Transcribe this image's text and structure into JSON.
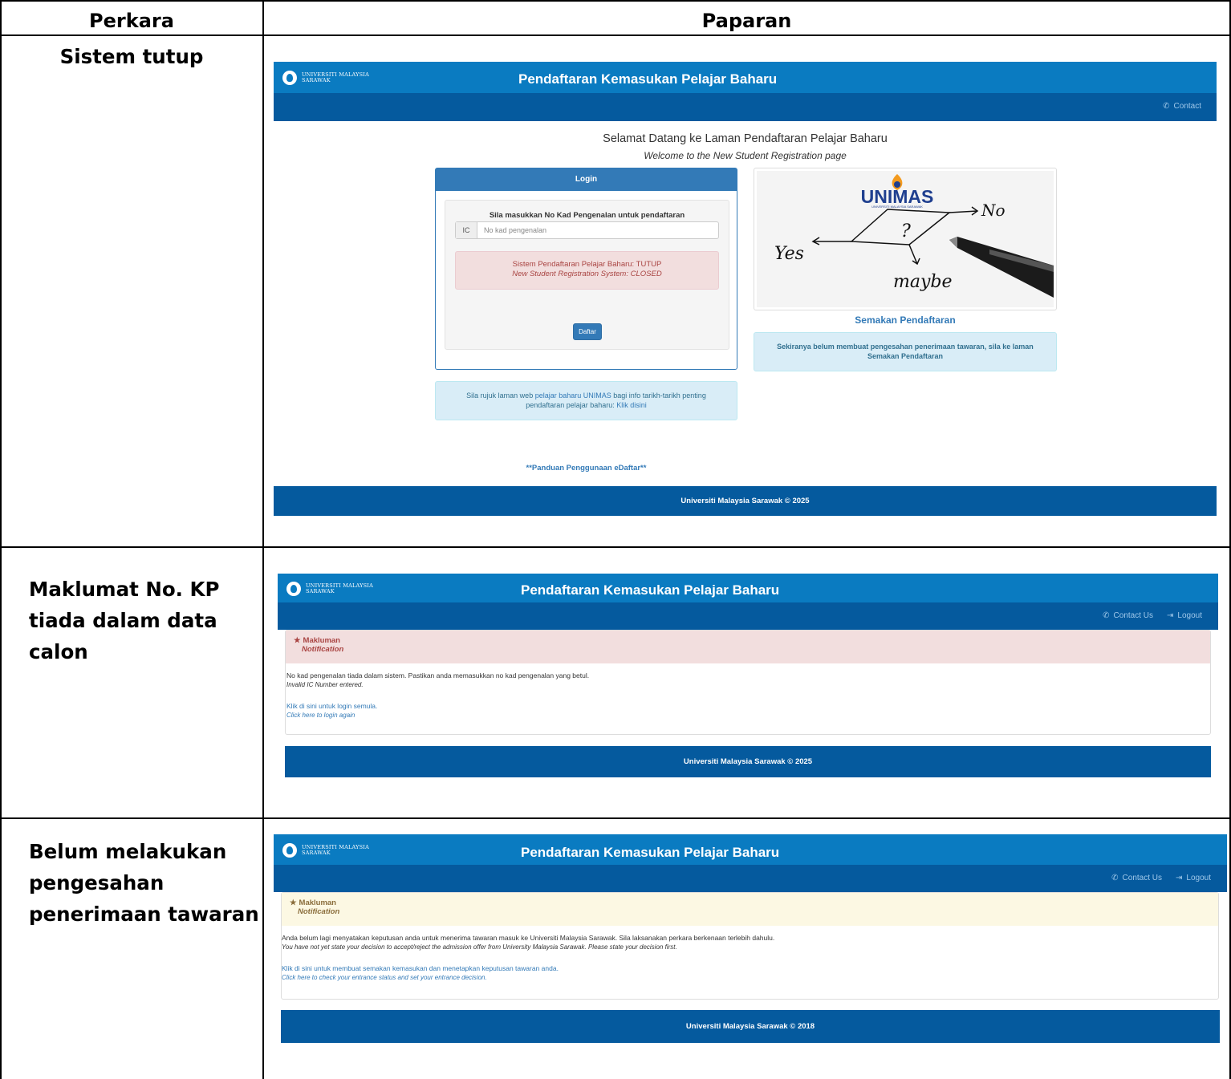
{
  "table": {
    "header_left": "Perkara",
    "header_right": "Paparan",
    "rows": [
      {
        "label_lines": [
          "Sistem tutup"
        ]
      },
      {
        "label_lines": [
          "Maklumat No. KP",
          "tiada dalam data",
          "calon"
        ]
      },
      {
        "label_lines": [
          "Belum melakukan",
          "pengesahan",
          "penerimaan tawaran"
        ]
      }
    ]
  },
  "app": {
    "logo_line1": "UNIVERSITI MALAYSIA",
    "logo_line2": "SARAWAK",
    "title": "Pendaftaran Kemasukan Pelajar Baharu"
  },
  "screen1": {
    "nav_contact": "Contact",
    "welcome_title": "Selamat Datang ke Laman Pendaftaran Pelajar Baharu",
    "welcome_sub": "Welcome to the New Student Registration page",
    "login_title": "Login",
    "login_prompt": "Sila masukkan No Kad Pengenalan untuk pendaftaran",
    "ic_addon": "IC",
    "ic_placeholder": "No kad pengenalan",
    "closed_ms": "Sistem Pendaftaran Pelajar Baharu: TUTUP",
    "closed_en": "New Student Registration System: CLOSED",
    "daftar_button": "Daftar",
    "info_prefix": "Sila rujuk laman web ",
    "info_link": "pelajar baharu UNIMAS",
    "info_middle": " bagi info tarikh-tarikh penting pendaftaran pelajar baharu: ",
    "info_link2": "Klik disini",
    "panduan": "**Panduan Penggunaan eDaftar**",
    "image_brand": "UNIMAS",
    "image_brand_sub": "UNIVERSITI MALAYSIA SARAWAK",
    "image_words": {
      "yes": "Yes",
      "no": "No",
      "maybe": "maybe",
      "q": "?"
    },
    "semakan_title": "Semakan Pendaftaran",
    "semakan_text": "Sekiranya belum membuat pengesahan penerimaan tawaran, sila ke laman Semakan Pendaftaran",
    "footer": "Universiti Malaysia Sarawak © 2025"
  },
  "screen2": {
    "nav_contact": "Contact Us",
    "nav_logout": "Logout",
    "notif_title": "Makluman",
    "notif_sub": "Notification",
    "msg_ms": "No kad pengenalan tiada dalam sistem. Pastikan anda memasukkan no kad pengenalan yang betul.",
    "msg_en": "Invalid IC Number entered.",
    "link_ms": "Klik di sini untuk login semula.",
    "link_en": "Click here to login again",
    "footer": "Universiti Malaysia Sarawak © 2025"
  },
  "screen3": {
    "nav_contact": "Contact Us",
    "nav_logout": "Logout",
    "notif_title": "Makluman",
    "notif_sub": "Notification",
    "msg_ms": "Anda belum lagi menyatakan keputusan anda untuk menerima tawaran masuk ke Universiti Malaysia Sarawak. Sila laksanakan perkara berkenaan terlebih dahulu.",
    "msg_en": "You have not yet state your decision to accept/reject the admission offer from University Malaysia Sarawak. Please state your decision first.",
    "link_ms": "Klik di sini untuk membuat semakan kemasukan dan menetapkan keputusan tawaran anda.",
    "link_en": "Click here to check your entrance status and set your entrance decision.",
    "footer": "Universiti Malaysia Sarawak © 2018"
  },
  "colors": {
    "topbar": "#0a7bc1",
    "navbar": "#055a9e",
    "danger_bg": "#f2dede",
    "danger_text": "#a94442",
    "warning_bg": "#fcf8e3",
    "warning_text": "#8a6d3b",
    "info_bg": "#d9edf7",
    "link": "#337ab7"
  },
  "icons": {
    "phone": "phone-icon",
    "logout": "logout-icon",
    "star": "star-icon",
    "logo": "unimas-logo-icon"
  }
}
